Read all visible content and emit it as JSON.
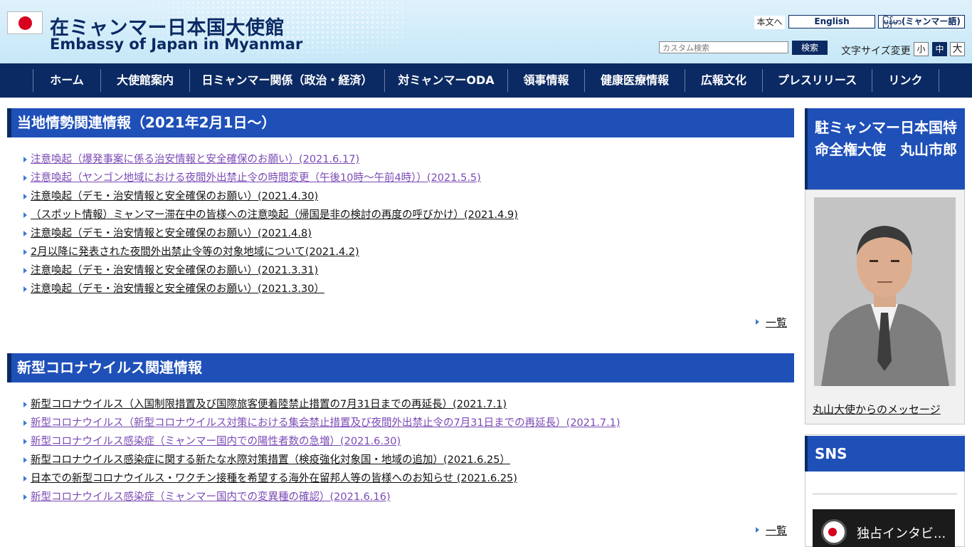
{
  "header": {
    "title_ja": "在ミャンマー日本国大使館",
    "title_en": "Embassy of Japan in Myanmar",
    "skip_link": "本文へ",
    "lang_en": "English",
    "lang_my": "မြန်မာ(ミャンマー語)",
    "search_placeholder": "カスタム検索",
    "search_button": "検索",
    "fontsize_label": "文字サイズ変更",
    "fontsize_small": "小",
    "fontsize_medium": "中",
    "fontsize_large": "大"
  },
  "nav": {
    "items": [
      {
        "label": "ホーム"
      },
      {
        "label": "大使館案内"
      },
      {
        "label": "日ミャンマー関係（政治・経済）"
      },
      {
        "label": "対ミャンマーODA"
      },
      {
        "label": "領事情報"
      },
      {
        "label": "健康医療情報"
      },
      {
        "label": "広報文化"
      },
      {
        "label": "プレスリリース"
      },
      {
        "label": "リンク"
      }
    ]
  },
  "local_info": {
    "heading": "当地情勢関連情報（2021年2月1日〜）",
    "items": [
      {
        "text": "注意喚起（爆発事案に係る治安情報と安全確保のお願い）(2021.6.17)",
        "visited": true
      },
      {
        "text": "注意喚起（ヤンゴン地域における夜間外出禁止令の時間変更（午後10時〜午前4時））(2021.5.5)",
        "visited": true
      },
      {
        "text": "注意喚起（デモ・治安情報と安全確保のお願い）(2021.4.30)",
        "visited": false
      },
      {
        "text": "（スポット情報）ミャンマー滞在中の皆様への注意喚起（帰国是非の検討の再度の呼びかけ）(2021.4.9)",
        "visited": false
      },
      {
        "text": "注意喚起（デモ・治安情報と安全確保のお願い）(2021.4.8)",
        "visited": false
      },
      {
        "text": "2月以降に発表された夜間外出禁止令等の対象地域について(2021.4.2)",
        "visited": false
      },
      {
        "text": "注意喚起（デモ・治安情報と安全確保のお願い）(2021.3.31)",
        "visited": false
      },
      {
        "text": "注意喚起（デモ・治安情報と安全確保のお願い）(2021.3.30）",
        "visited": false
      }
    ],
    "more": "一覧"
  },
  "covid_info": {
    "heading": "新型コロナウイルス関連情報",
    "items": [
      {
        "text": "新型コロナウイルス（入国制限措置及び国際旅客便着陸禁止措置の7月31日までの再延長）(2021.7.1)",
        "visited": false
      },
      {
        "text": "新型コロナウイルス（新型コロナウイルス対策における集会禁止措置及び夜間外出禁止令の7月31日までの再延長）(2021.7.1)",
        "visited": true
      },
      {
        "text": "新型コロナウイルス感染症（ミャンマー国内での陽性者数の急増）(2021.6.30)",
        "visited": true
      },
      {
        "text": "新型コロナウイルス感染症に関する新たな水際対策措置（検疫強化対象国・地域の追加）(2021.6.25）",
        "visited": false
      },
      {
        "text": "日本での新型コロナウイルス・ワクチン接種を希望する海外在留邦人等の皆様へのお知らせ (2021.6.25)",
        "visited": false
      },
      {
        "text": "新型コロナウイルス感染症（ミャンマー国内での変異種の確認）(2021.6.16)",
        "visited": true
      }
    ],
    "more": "一覧"
  },
  "sidebar": {
    "ambassador_heading": "駐ミャンマー日本国特命全権大使　丸山市郎",
    "ambassador_message": "丸山大使からのメッセージ",
    "sns_heading": "SNS",
    "video_title": "独占インタビ..."
  },
  "colors": {
    "navy": "#0b2a63",
    "section_blue": "#1f50b8",
    "visited_link": "#7b4ab5"
  }
}
